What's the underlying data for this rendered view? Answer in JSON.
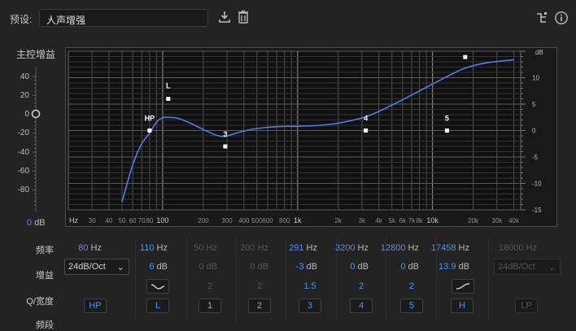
{
  "preset": {
    "label": "预设:",
    "value": "人声增强"
  },
  "toolbar_icons": [
    "download-icon",
    "trash-icon",
    "routing-icon",
    "info-icon"
  ],
  "master": {
    "label": "主控增益",
    "ticks": [
      "40",
      "20",
      "0",
      "-20",
      "-40",
      "-60",
      "-80"
    ],
    "value": "0",
    "unit": "dB",
    "gain_db": 0
  },
  "axis": {
    "freq_labels": [
      "Hz",
      "30",
      "40",
      "50",
      "60",
      "70",
      "80",
      "100",
      "200",
      "300",
      "400",
      "500",
      "600",
      "800",
      "1k",
      "2k",
      "3k",
      "4k",
      "5k",
      "6k",
      "7k",
      "8k",
      "10k",
      "20k",
      "30k",
      "40k"
    ],
    "db_header": "dB",
    "db_labels": [
      "10",
      "5",
      "0",
      "-5",
      "-10",
      "-15"
    ]
  },
  "chart_data": {
    "type": "line",
    "xscale": "log",
    "xlim": [
      20,
      45000
    ],
    "ylim": [
      -15,
      15
    ],
    "xlabel": "Hz",
    "ylabel": "dB",
    "series": [
      {
        "x": [
          50,
          60,
          70,
          80,
          90,
          100,
          110,
          130,
          160,
          200,
          250,
          291,
          350,
          450,
          600,
          800,
          1000,
          1500,
          2000,
          3200,
          5000,
          8000,
          12800,
          17458,
          25000,
          40000
        ],
        "y": [
          -13.5,
          -6.5,
          -2.5,
          -0.5,
          1.6,
          2.4,
          2.5,
          2.3,
          1.4,
          0.2,
          -0.9,
          -1.1,
          -0.5,
          0.2,
          0.6,
          0.8,
          0.8,
          1.0,
          1.4,
          2.6,
          4.8,
          7.5,
          10.2,
          11.8,
          12.8,
          13.4
        ]
      }
    ],
    "nodes": [
      {
        "label": "HP",
        "x": 80,
        "y": 0
      },
      {
        "label": "L",
        "x": 110,
        "y": 6
      },
      {
        "label": "3",
        "x": 291,
        "y": -3
      },
      {
        "label": "4",
        "x": 3200,
        "y": 0
      },
      {
        "label": "5",
        "x": 12800,
        "y": 0
      },
      {
        "label": "",
        "x": 17458,
        "y": 13.9
      }
    ]
  },
  "rows": {
    "freq": "频率",
    "gain": "增益",
    "q": "Q/宽度",
    "band": "频段"
  },
  "slope_hp": "24dB/Oct",
  "slope_lp": "24dB/Oct",
  "bands": [
    {
      "freq": "80",
      "freq_unit": "Hz",
      "gain": "",
      "gain_unit": "",
      "q": "",
      "button": "HP",
      "state": "on"
    },
    {
      "freq": "110",
      "freq_unit": "Hz",
      "gain": "6",
      "gain_unit": "dB",
      "q": "",
      "button": "L",
      "state": "on"
    },
    {
      "freq": "50",
      "freq_unit": "Hz",
      "gain": "0",
      "gain_unit": "dB",
      "q": "2",
      "button": "1",
      "state": "off"
    },
    {
      "freq": "200",
      "freq_unit": "Hz",
      "gain": "0",
      "gain_unit": "dB",
      "q": "2",
      "button": "2",
      "state": "off"
    },
    {
      "freq": "291",
      "freq_unit": "Hz",
      "gain": "-3",
      "gain_unit": "dB",
      "q": "1.5",
      "button": "3",
      "state": "on"
    },
    {
      "freq": "3200",
      "freq_unit": "Hz",
      "gain": "0",
      "gain_unit": "dB",
      "q": "2",
      "button": "4",
      "state": "on"
    },
    {
      "freq": "12800",
      "freq_unit": "Hz",
      "gain": "0",
      "gain_unit": "dB",
      "q": "2",
      "button": "5",
      "state": "on"
    },
    {
      "freq": "17458",
      "freq_unit": "Hz",
      "gain": "13.9",
      "gain_unit": "dB",
      "q": "",
      "button": "H",
      "state": "on"
    },
    {
      "freq": "18000",
      "freq_unit": "Hz",
      "gain": "",
      "gain_unit": "",
      "q": "",
      "button": "LP",
      "state": "dis"
    }
  ],
  "colors": {
    "accent": "#4a90ff",
    "curve": "#5b78e6",
    "background": "#232323",
    "plot_bg": "#191919"
  }
}
